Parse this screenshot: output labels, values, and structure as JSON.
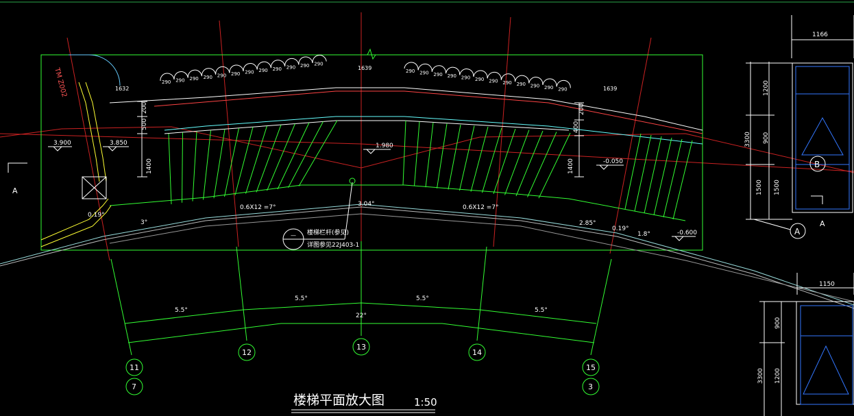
{
  "drawing": {
    "title": "楼梯平面放大图",
    "scale": "1:50",
    "top_stair_run_widths": [
      "290",
      "290",
      "290",
      "290",
      "290",
      "290",
      "290",
      "290",
      "290",
      "290",
      "290",
      "290"
    ],
    "top_stair_run_widths_right": [
      "290",
      "290",
      "290",
      "290",
      "290",
      "290",
      "290",
      "290",
      "290",
      "290",
      "290",
      "290"
    ],
    "curve_dim_1639": "1639",
    "curve_dim_1632": "1632",
    "curve_dim_1639b": "1639",
    "mid_elev": "1.980",
    "left_elev_1": "3.900",
    "left_elev_2": "3.850",
    "right_elev_1": "-0.050",
    "right_elev_2": "-0.600",
    "wall_tag": "TM Z002",
    "left_dims": [
      "200",
      "500",
      "1400"
    ],
    "right_dims": [
      "200",
      "400",
      "1400"
    ],
    "angles": {
      "a_left": "3°",
      "a_run_left": "0.6X12 =7°",
      "a_mid": "3.04°",
      "a_run_right": "0.6X12 =7°",
      "a_r1": "2.85°",
      "a_r2": "0.19°",
      "a_r3": "1.8°",
      "a_l_small": "0.19°"
    },
    "bottom_angles": [
      "5.5°",
      "5.5°",
      "5.5°",
      "5.5°"
    ],
    "bottom_total": "22°",
    "grid_bubbles": [
      {
        "label": "11",
        "sub": "7"
      },
      {
        "label": "12"
      },
      {
        "label": "13"
      },
      {
        "label": "14"
      },
      {
        "label": "15",
        "sub": "3"
      }
    ],
    "note_line1": "楼梯栏杆(参见)",
    "note_line2": "详图参见22J403-1",
    "note_bubble": "—",
    "section_mark_left": "A",
    "right_details": {
      "top_width": "1166",
      "dim_1200": "1200",
      "dim_900": "900",
      "dim_3300": "3300",
      "dim_1500a": "1500",
      "dim_1500b": "1500",
      "bubble_B": "B",
      "bubble_A": "A",
      "section_A": "A",
      "bottom_width": "1150",
      "dim_900b": "900",
      "dim_1200b": "1200",
      "dim_3300b": "3300"
    },
    "colors": {
      "background": "#000000",
      "green": "#33ff33",
      "white": "#ffffff",
      "red": "#ff3333",
      "cyan": "#33ffff",
      "yellow": "#ffff33",
      "blue": "#3377ff"
    }
  }
}
